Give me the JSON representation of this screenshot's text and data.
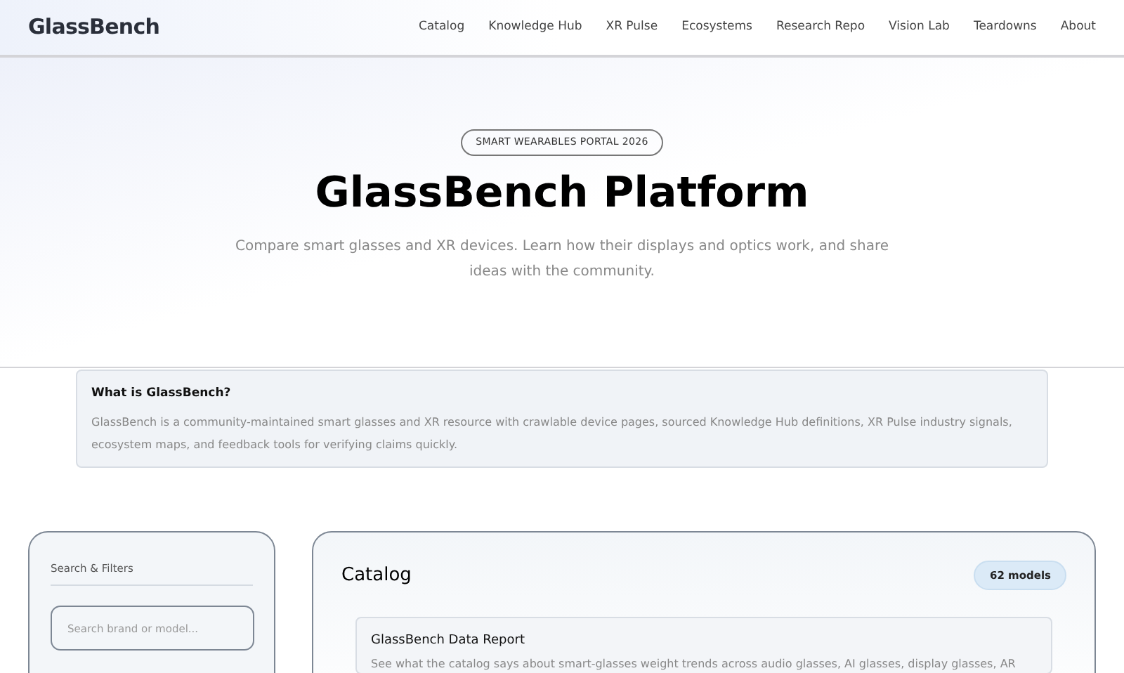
{
  "brand": "GlassBench",
  "nav": [
    "Catalog",
    "Knowledge Hub",
    "XR Pulse",
    "Ecosystems",
    "Research Repo",
    "Vision Lab",
    "Teardowns",
    "About"
  ],
  "hero": {
    "badge": "SMART WEARABLES PORTAL 2026",
    "title": "GlassBench Platform",
    "subtitle": "Compare smart glasses and XR devices. Learn how their displays and optics work, and share ideas with the community."
  },
  "info": {
    "title": "What is GlassBench?",
    "text": "GlassBench is a community-maintained smart glasses and XR resource with crawlable device pages, sourced Knowledge Hub definitions, XR Pulse industry signals, ecosystem maps, and feedback tools for verifying claims quickly."
  },
  "sidebar": {
    "title": "Search & Filters",
    "search": {
      "placeholder": "Search brand or model..."
    }
  },
  "catalog": {
    "title": "Catalog",
    "count": "62 models",
    "report": {
      "title": "GlassBench Data Report",
      "text": "See what the catalog says about smart-glasses weight trends across audio glasses, AI glasses, display glasses, AR"
    }
  }
}
